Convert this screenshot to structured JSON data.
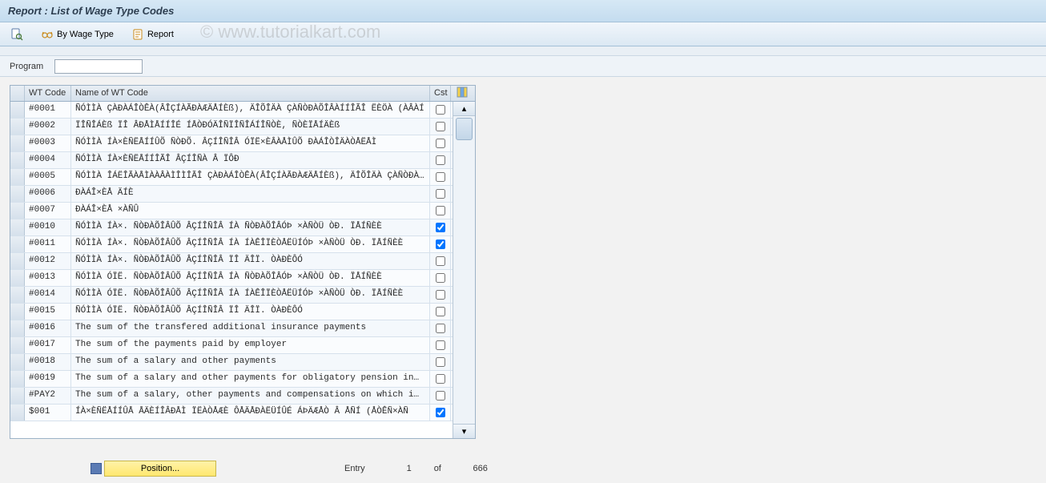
{
  "header": {
    "title": "Report : List of Wage Type Codes"
  },
  "watermark": "© www.tutorialkart.com",
  "toolbar": {
    "by_wage_type_label": "By Wage Type",
    "report_label": "Report"
  },
  "program": {
    "label": "Program",
    "value": ""
  },
  "grid": {
    "columns": {
      "wt_code": "WT Code",
      "name": "Name of WT Code",
      "cst": "Cst"
    },
    "rows": [
      {
        "code": "#0001",
        "name": "ÑÓÌÌÀ ÇÀÐÀÁÎÒÊÀ(ÂÎÇÍÀÃÐÀÆÄÅÍÈß), ÄÎÕÎÄÀ ÇÀÑÒÐÀÕÎÂÀÍÍÎÃÎ ËÈÖÀ (ÀÂÀÍ",
        "cst": false
      },
      {
        "code": "#0002",
        "name": "ÏÎÑÎÁÈß ÏÎ ÂÐÅÌÅÍÍÎÉ ÍÅÒÐÓÄÎÑÏÎÑÎÁÍÎÑÒÈ, ÑÒÈÏÅÍÄÈß",
        "cst": false
      },
      {
        "code": "#0003",
        "name": "ÑÓÌÌÀ ÍÀ×ÈÑËÅÍÍÛÕ ÑÒÐÕ. ÂÇÍÎÑÎÂ ÓÏË×ÈÂÀÅÌÛÕ ÐÀÁÎÒÎÄÀÒÅËÅÌ",
        "cst": false
      },
      {
        "code": "#0004",
        "name": "ÑÓÌÌÀ ÍÀ×ÈÑËÅÍÍÎÃÎ ÂÇÍÎÑÀ Â ÏÔÐ",
        "cst": false
      },
      {
        "code": "#0005",
        "name": "ÑÓÌÌÀ ÎÁËÎÃÀÅÌÀÀÂÀÌÎÌÎÃÎ ÇÀÐÀÁÎÒÊÀ(ÂÎÇÍÀÃÐÀÆÄÅÍÈß), ÄÎÕÎÄÀ ÇÀÑÒÐÀÕÍ",
        "cst": false
      },
      {
        "code": "#0006",
        "name": "ÐÀÁÎ×ÈÅ ÄÍÈ",
        "cst": false
      },
      {
        "code": "#0007",
        "name": "ÐÀÁÎ×ÈÅ ×ÀÑÛ",
        "cst": false
      },
      {
        "code": "#0010",
        "name": "ÑÓÌÌÀ ÍÀ×. ÑÒÐÀÕÎÂÛÕ ÂÇÍÎÑÎÂ ÍÀ ÑÒÐÀÕÎÂÓÞ ×ÀÑÒÜ ÒÐ. ÏÅÍÑÈÈ",
        "cst": true
      },
      {
        "code": "#0011",
        "name": "ÑÓÌÌÀ ÍÀ×. ÑÒÐÀÕÎÂÛÕ ÂÇÍÎÑÎÂ ÍÀ ÍÀÊÎÏÈÒÅËÜÍÓÞ ×ÀÑÒÜ ÒÐ. ÏÅÍÑÈÈ",
        "cst": true
      },
      {
        "code": "#0012",
        "name": "ÑÓÌÌÀ ÍÀ×. ÑÒÐÀÕÎÂÛÕ ÂÇÍÎÑÎÂ ÏÎ ÄÎÏ. ÒÀÐÈÔÓ",
        "cst": false
      },
      {
        "code": "#0013",
        "name": "ÑÓÌÌÀ ÓÏË. ÑÒÐÀÕÎÂÛÕ ÂÇÍÎÑÎÂ ÍÀ ÑÒÐÀÕÎÂÓÞ ×ÀÑÒÜ ÒÐ. ÏÅÍÑÈÈ",
        "cst": false
      },
      {
        "code": "#0014",
        "name": "ÑÓÌÌÀ ÓÏË. ÑÒÐÀÕÎÂÛÕ ÂÇÍÎÑÎÂ ÍÀ ÍÀÊÎÏÈÒÅËÜÍÓÞ ×ÀÑÒÜ ÒÐ. ÏÅÍÑÈÈ",
        "cst": false
      },
      {
        "code": "#0015",
        "name": "ÑÓÌÌÀ ÓÏË. ÑÒÐÀÕÎÂÛÕ ÂÇÍÎÑÎÂ ÏÎ ÄÎÏ. ÒÀÐÈÔÓ",
        "cst": false
      },
      {
        "code": "#0016",
        "name": "The sum of the transfered additional insurance payments",
        "cst": false
      },
      {
        "code": "#0017",
        "name": "The sum of the payments paid by employer",
        "cst": false
      },
      {
        "code": "#0018",
        "name": "The sum of a salary and other payments",
        "cst": false
      },
      {
        "code": "#0019",
        "name": "The sum of a salary and other payments for obligatory pension in…",
        "cst": false
      },
      {
        "code": "#PAY2",
        "name": "The sum of a salary, other payments and compensations on which i…",
        "cst": false
      },
      {
        "code": "$001",
        "name": "ÍÀ×ÈÑËÅÍÍÛÅ ÅÄÈÍÎÂÐÅÌ ÏËÀÒÅÆÈ ÔÅÄÅÐÀËÜÍÛÉ ÁÞÄÆÅÒ Â ÅÑÍ (ÅÒÊÑ×ÀÑ",
        "cst": true
      }
    ]
  },
  "footer": {
    "position_label": "Position...",
    "entry_label": "Entry",
    "current": "1",
    "of_label": "of",
    "total": "666"
  }
}
